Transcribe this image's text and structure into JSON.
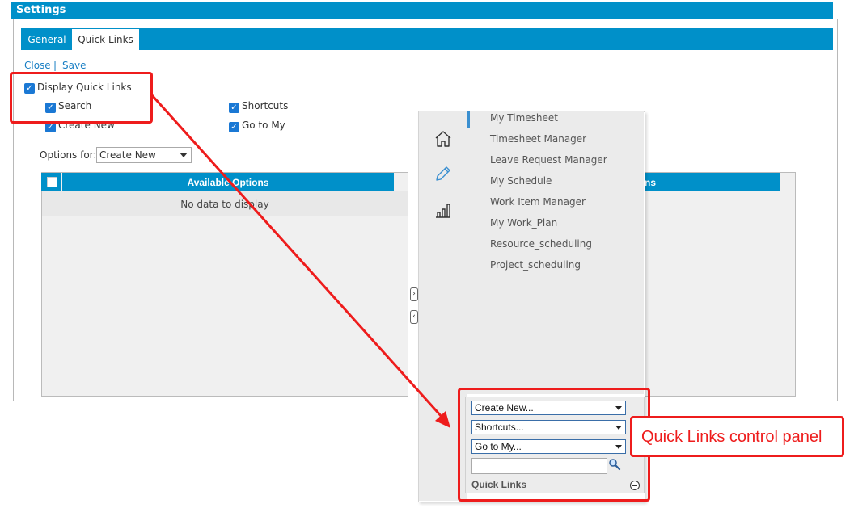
{
  "window": {
    "title": "Settings"
  },
  "tabs": [
    {
      "label": "General"
    },
    {
      "label": "Quick Links"
    }
  ],
  "actions": {
    "close": "Close",
    "separator": "|",
    "save": "Save"
  },
  "quick_links_settings": {
    "display_label": "Display Quick Links",
    "display_checked": true,
    "options": [
      {
        "label": "Search",
        "checked": true
      },
      {
        "label": "Shortcuts",
        "checked": true
      },
      {
        "label": "Create New",
        "checked": true
      },
      {
        "label": "Go to My",
        "checked": true
      }
    ]
  },
  "options_for": {
    "label": "Options for:",
    "value": "Create New"
  },
  "available_grid": {
    "header": "Available Options",
    "empty_text": "No data to display"
  },
  "selected_grid": {
    "header_visible_fragment": "ns"
  },
  "flyout": {
    "rail_icons": [
      "home-icon",
      "pencil-icon",
      "bar-chart-icon"
    ],
    "items": [
      "My Timesheet",
      "Timesheet Manager",
      "Leave Request Manager",
      "My Schedule",
      "Work Item Manager",
      "My Work_Plan",
      "Resource_scheduling",
      "Project_scheduling"
    ]
  },
  "quick_links_panel": {
    "create_new": "Create New...",
    "shortcuts": "Shortcuts...",
    "go_to_my": "Go to My...",
    "search_value": "",
    "title": "Quick Links"
  },
  "annotation": {
    "callout": "Quick Links control panel",
    "color": "#ee1c1c"
  },
  "colors": {
    "header_blue": "#0090c9",
    "link_blue": "#1a7fc4",
    "checkbox_blue": "#1a78d4"
  }
}
